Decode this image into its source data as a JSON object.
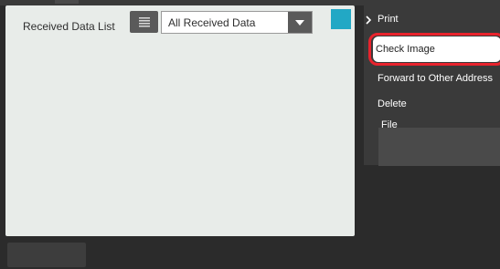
{
  "panel": {
    "title": "Received Data List",
    "filter": {
      "selected": "All Received Data"
    }
  },
  "menu": {
    "items": [
      {
        "label": "Print"
      },
      {
        "label": "Check Image"
      },
      {
        "label": "Forward to Other Address"
      },
      {
        "label": "Delete"
      },
      {
        "label": "File"
      }
    ]
  },
  "icons": {
    "list": "list-icon",
    "dropdown": "caret-down-icon",
    "chevron": "chevron-right-icon"
  },
  "colors": {
    "highlight": "#e8232d",
    "accent": "#22a8c5"
  }
}
